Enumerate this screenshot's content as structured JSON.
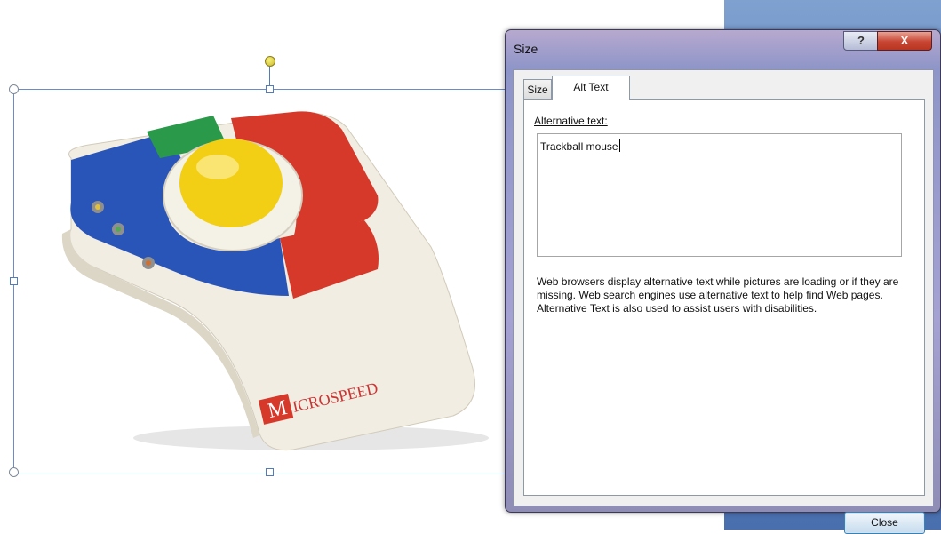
{
  "dialog": {
    "title": "Size",
    "help_label": "?",
    "close_x_label": "X",
    "tabs": [
      {
        "label": "Size",
        "selected": false
      },
      {
        "label": "Alt Text",
        "selected": true
      }
    ],
    "alt_text": {
      "label": "Alternative text:",
      "value": "Trackball mouse",
      "description": "Web browsers display alternative text while pictures are loading or if they are missing.  Web search engines use alternative text to help find Web pages.  Alternative Text is also used to assist users with disabilities."
    },
    "close_button_label": "Close"
  },
  "picture": {
    "brand": "MICROSPEED",
    "colors": {
      "blue": "#2a55b8",
      "red": "#d6382a",
      "green": "#2a9a4a",
      "ball": "#f2cf14",
      "body": "#f2efe6"
    }
  },
  "icons": [
    "rotate-handle-icon",
    "resize-handle-icon",
    "help-icon",
    "close-icon"
  ]
}
